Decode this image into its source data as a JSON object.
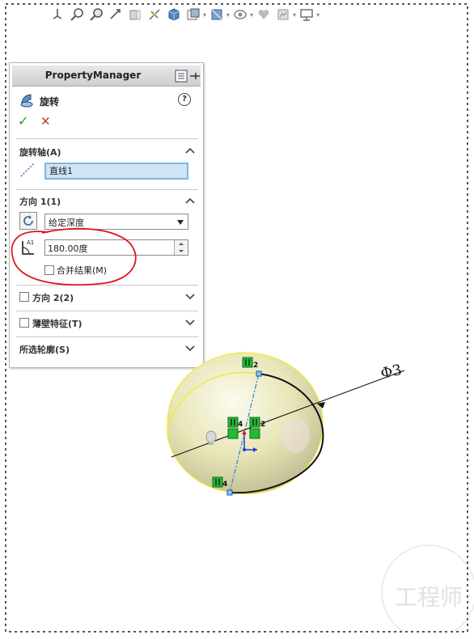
{
  "toolbar": {
    "icons": [
      "view-orient-icon",
      "zoom-fit-icon",
      "zoom-area-icon",
      "previous-view-icon",
      "section-view-icon",
      "dynamic-annotation-icon",
      "view-cube-icon",
      "display-style-icon",
      "hide-show-icon",
      "edit-appearance-icon",
      "apply-scene-icon",
      "view-settings-icon",
      "display-monitor-icon"
    ]
  },
  "property_manager": {
    "title": "PropertyManager",
    "feature_name": "旋转",
    "help": "?",
    "ok_symbol": "✓",
    "cancel_symbol": "✕",
    "axis_section": {
      "title": "旋转轴(A)",
      "value": "直线1"
    },
    "direction1": {
      "title": "方向 1(1)",
      "type_value": "给定深度",
      "angle_prefix": "A1",
      "angle_value": "180.00度",
      "merge_label": "合并结果(M)",
      "merge_checked": false
    },
    "direction2": {
      "title": "方向 2(2)",
      "checked": false
    },
    "thin_feature": {
      "title": "薄壁特征(T)",
      "checked": false
    },
    "selected_contours": {
      "title": "所选轮廓(S)"
    }
  },
  "viewport": {
    "dimension_label": "Φ3",
    "relation_numbers": [
      "2",
      "4",
      "2",
      "4"
    ]
  },
  "watermark": {
    "text": "工程师"
  },
  "colors": {
    "annotation_circle": "#e0121b",
    "relation_green": "#22bb33",
    "hemisphere": "#e9e6b8",
    "field_highlight": "#cfe5f7"
  }
}
